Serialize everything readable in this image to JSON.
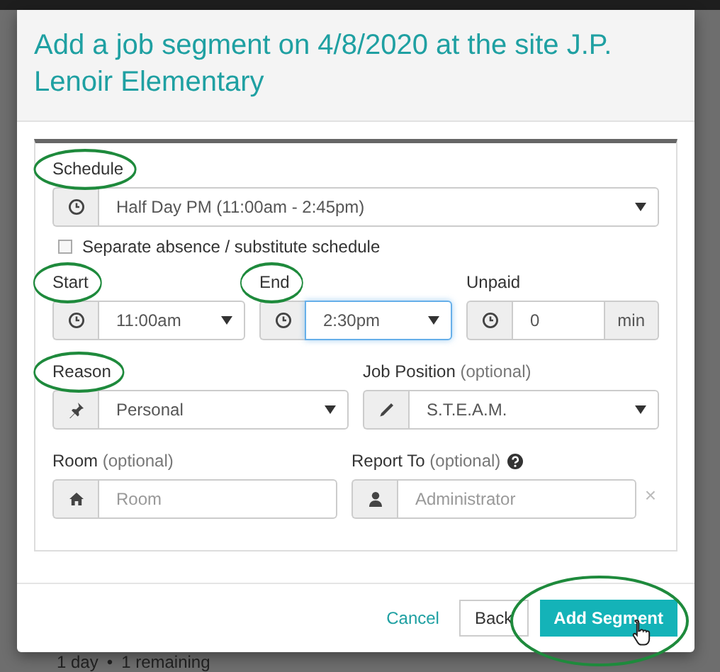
{
  "background": {
    "summary": [
      "1 day",
      "•",
      "1 remaining"
    ]
  },
  "modal": {
    "title": "Add a job segment on 4/8/2020 at the site J.P. Lenoir Elementary",
    "rows": [
      {
        "fields": [
          {
            "kind": "select",
            "label": "Schedule",
            "highlighted": true,
            "value": "Half Day PM (11:00am - 2:45pm)"
          }
        ]
      },
      {
        "fields": [
          {
            "kind": "checkbox",
            "label": "Separate absence / substitute schedule",
            "checked": false
          }
        ]
      },
      {
        "fields": [
          {
            "kind": "select",
            "label": "Start",
            "highlighted": true,
            "value": "11:00am"
          },
          {
            "kind": "select",
            "label": "End",
            "highlighted": true,
            "focused": true,
            "value": "2:30pm"
          },
          {
            "kind": "input",
            "label": "Unpaid",
            "value": "0",
            "unit": "min"
          }
        ]
      },
      {
        "fields": [
          {
            "kind": "select",
            "label": "Reason",
            "highlighted": true,
            "value": "Personal"
          },
          {
            "kind": "select",
            "label": "Job Position",
            "note": "(optional)",
            "value": "S.T.E.A.M."
          }
        ]
      },
      {
        "fields": [
          {
            "kind": "input",
            "label": "Room",
            "note": "(optional)",
            "placeholder": "Room"
          },
          {
            "kind": "input",
            "label": "Report To",
            "note": "(optional)",
            "help": true,
            "placeholder": "Administrator",
            "clear": "×"
          }
        ]
      }
    ],
    "buttons": [
      {
        "kind": "link",
        "label": "Cancel"
      },
      {
        "kind": "default",
        "label": "Back"
      },
      {
        "kind": "primary",
        "label": "Add Segment",
        "highlighted": true,
        "hovered": true
      }
    ]
  }
}
